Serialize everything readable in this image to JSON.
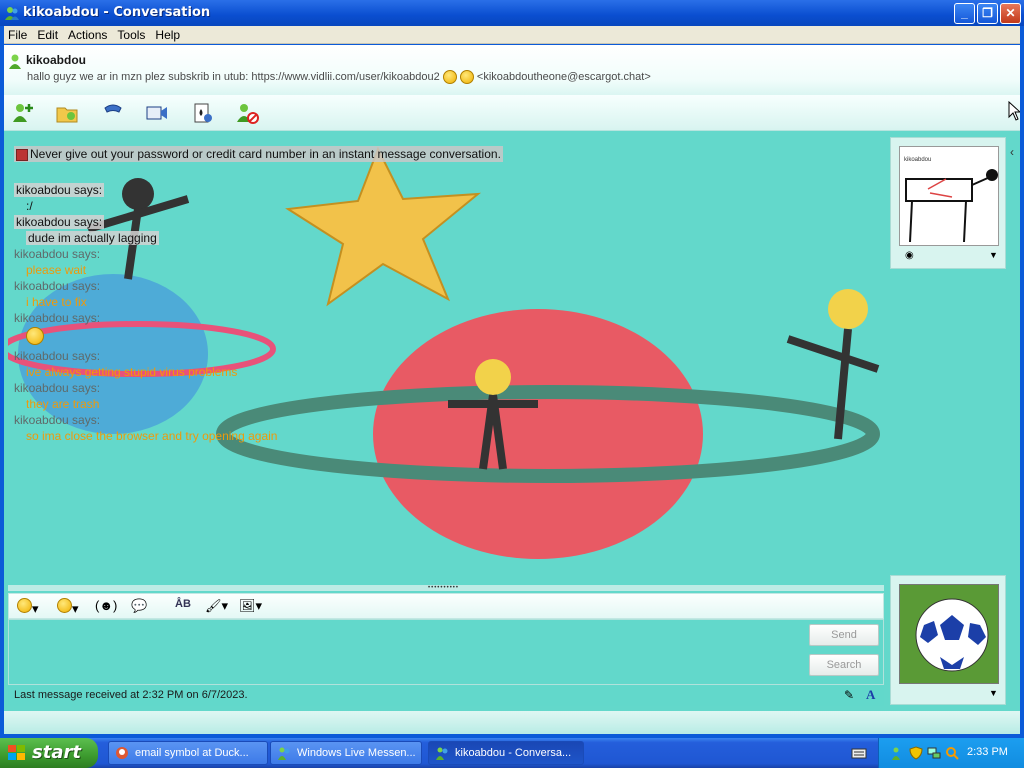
{
  "window": {
    "title": "kikoabdou - Conversation",
    "minimize_label": "_",
    "maximize_label": "❐",
    "close_label": "✕"
  },
  "menu": [
    "File",
    "Edit",
    "Actions",
    "Tools",
    "Help"
  ],
  "header": {
    "contact_name": "kikoabdou",
    "psm_text": "hallo guyz we ar in mzn plez subskrib in utub: https://www.vidlii.com/user/kikoabdou2",
    "email": "<kikoabdoutheone@escargot.chat>"
  },
  "toolbar_icons": [
    "invite-contact-icon",
    "share-files-icon",
    "call-icon",
    "video-icon",
    "games-icon",
    "block-contact-icon"
  ],
  "conversation": {
    "warning": "Never give out your password or credit card number in an instant message conversation.",
    "messages": [
      {
        "sender": "kikoabdou says:",
        "text": ":/"
      },
      {
        "sender": "kikoabdou says:",
        "text": "dude im actually lagging"
      },
      {
        "sender": "kikoabdou says:",
        "text": "please wait"
      },
      {
        "sender": "kikoabdou says:",
        "text": "i have to fix"
      },
      {
        "sender": "kikoabdou says:",
        "text": "🙂"
      },
      {
        "sender": "kikoabdou says:",
        "text": "ive always getting stupid virus problems"
      },
      {
        "sender": "kikoabdou says:",
        "text": "they are trash"
      },
      {
        "sender": "kikoabdou says:",
        "text": "so ima close the browser and try opening again"
      }
    ]
  },
  "avatar_top": {
    "caption": "kikoabdou"
  },
  "compose": {
    "send_label": "Send",
    "search_label": "Search",
    "status": "Last message received at 2:32 PM on 6/7/2023."
  },
  "taskbar": {
    "start_label": "start",
    "tasks": [
      {
        "label": "email symbol at Duck..."
      },
      {
        "label": "Windows Live Messen..."
      },
      {
        "label": "kikoabdou - Conversa..."
      }
    ],
    "clock": "2:33 PM"
  },
  "colors": {
    "accent": "#63d8cb",
    "title_bar": "#0a4ed0",
    "orange_text": "#ef9a0a",
    "start_green": "#3c9a2e"
  }
}
